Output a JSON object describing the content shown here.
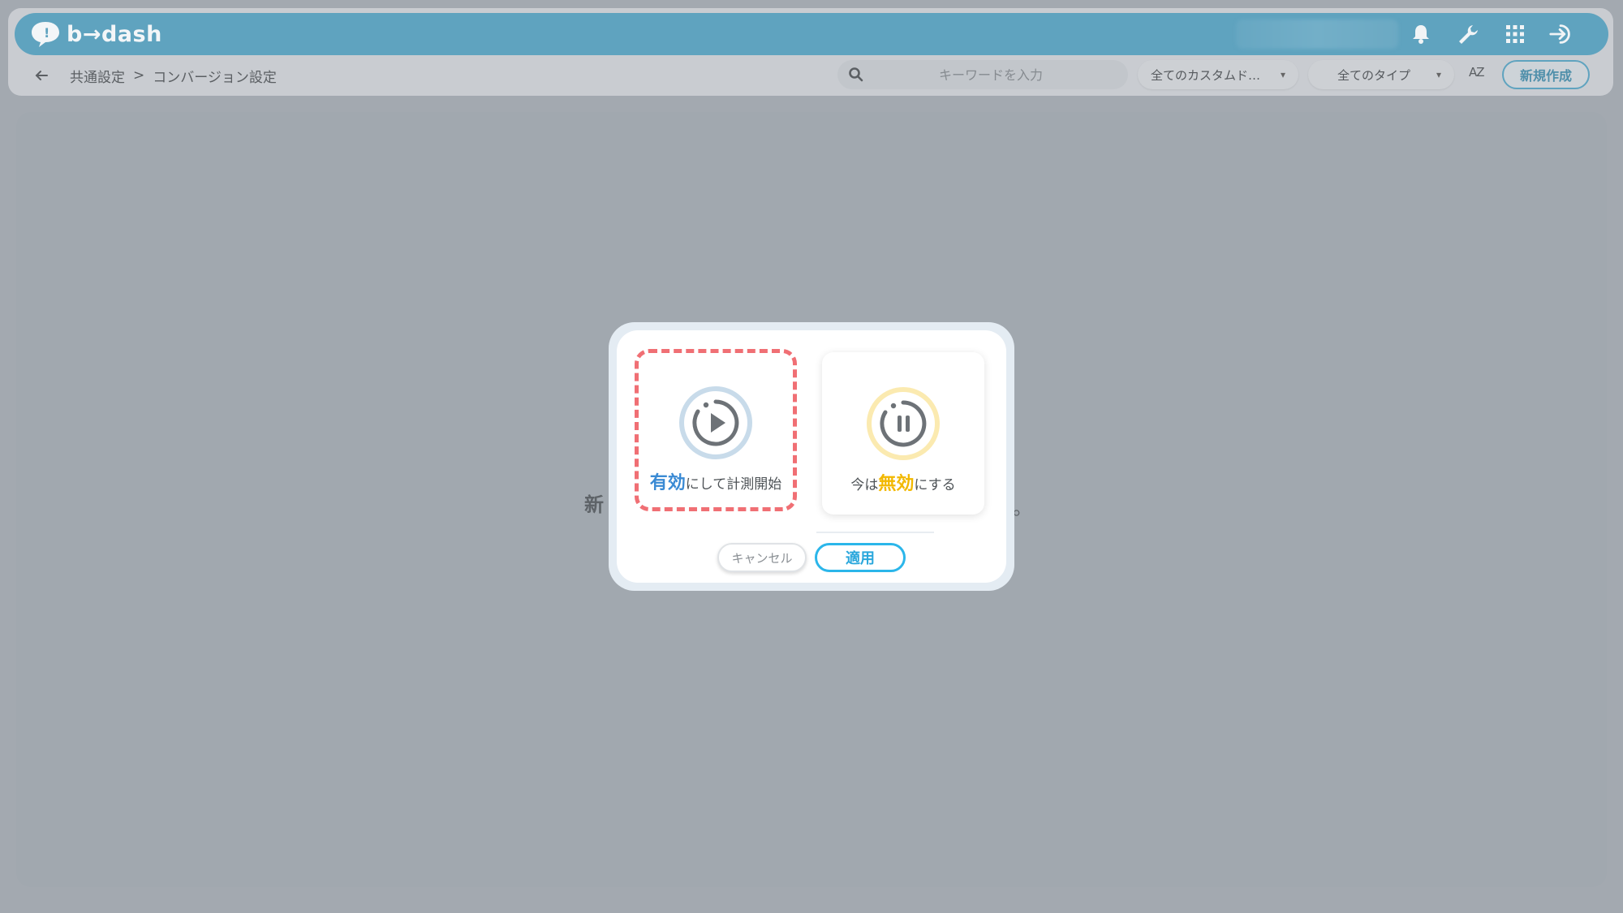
{
  "app": {
    "logo_text": "b→dash"
  },
  "header": {
    "icons": [
      "bell-icon",
      "wrench-icon",
      "apps-grid-icon",
      "logout-icon"
    ]
  },
  "toolbar": {
    "breadcrumb_parent": "共通設定",
    "breadcrumb_separator": ">",
    "breadcrumb_current": "コンバージョン設定",
    "search_placeholder": "キーワードを入力",
    "custom_filter": "全てのカスタムド…",
    "type_filter": "全てのタイプ",
    "sort_label": "AZ",
    "new_button": "新規作成"
  },
  "background": {
    "message_start": "新",
    "message_end": "。"
  },
  "modal": {
    "enable_option": {
      "highlight": "有効",
      "rest": "にして計測開始"
    },
    "disable_option": {
      "prefix": "今は",
      "highlight": "無効",
      "rest": "にする"
    },
    "cancel_button": "キャンセル",
    "apply_button": "適用"
  },
  "colors": {
    "topbar": "#5fa3bf",
    "enable_accent": "#3a8ad4",
    "disable_accent": "#f2b800",
    "selection_border": "#f06f74",
    "apply_border": "#2bb6ea"
  }
}
